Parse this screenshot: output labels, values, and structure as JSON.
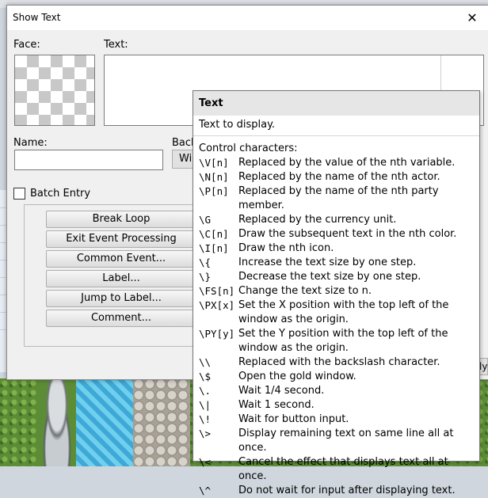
{
  "dialog": {
    "title": "Show Text",
    "close_glyph": "✕",
    "face_label": "Face:",
    "text_label": "Text:",
    "name_label": "Name:",
    "background_label": "Back",
    "window_button": "Wi",
    "batch_entry_label": "Batch Entry"
  },
  "command_list": {
    "items": [
      {
        "label": "Break Loop"
      },
      {
        "label": "Exit Event Processing"
      },
      {
        "label": "Common Event..."
      },
      {
        "label": "Label..."
      },
      {
        "label": "Jump to Label..."
      },
      {
        "label": "Comment..."
      }
    ],
    "partial_right_label": "ly"
  },
  "tooltip": {
    "title": "Text",
    "description": "Text to display.",
    "control_header": "Control characters:",
    "codes": [
      {
        "code": "\\V[n]",
        "text": "Replaced by the value of the nth variable."
      },
      {
        "code": "\\N[n]",
        "text": "Replaced by the name of the nth actor."
      },
      {
        "code": "\\P[n]",
        "text": "Replaced by the name of the nth party member."
      },
      {
        "code": "\\G",
        "text": "Replaced by the currency unit."
      },
      {
        "code": "\\C[n]",
        "text": "Draw the subsequent text in the nth color."
      },
      {
        "code": "\\I[n]",
        "text": "Draw the nth icon."
      },
      {
        "code": "\\{",
        "text": "Increase the text size by one step."
      },
      {
        "code": "\\}",
        "text": "Decrease the text size by one step."
      },
      {
        "code": "\\FS[n]",
        "text": "Change the text size to n."
      },
      {
        "code": "\\PX[x]",
        "text": "Set the X position with the top left of the\nwindow as the origin."
      },
      {
        "code": "\\PY[y]",
        "text": "Set the Y position with the top left of the\nwindow as the origin."
      },
      {
        "code": "\\\\",
        "text": "Replaced with the backslash character."
      },
      {
        "code": "\\$",
        "text": "Open the gold window."
      },
      {
        "code": "\\.",
        "text": "Wait 1/4 second."
      },
      {
        "code": "\\|",
        "text": "Wait 1 second."
      },
      {
        "code": "\\!",
        "text": "Wait for button input."
      },
      {
        "code": "\\>",
        "text": "Display remaining text on same line all at once."
      },
      {
        "code": "\\<",
        "text": "Cancel the effect that displays text all at once."
      },
      {
        "code": "\\^",
        "text": "Do not wait for input after displaying text."
      }
    ]
  }
}
